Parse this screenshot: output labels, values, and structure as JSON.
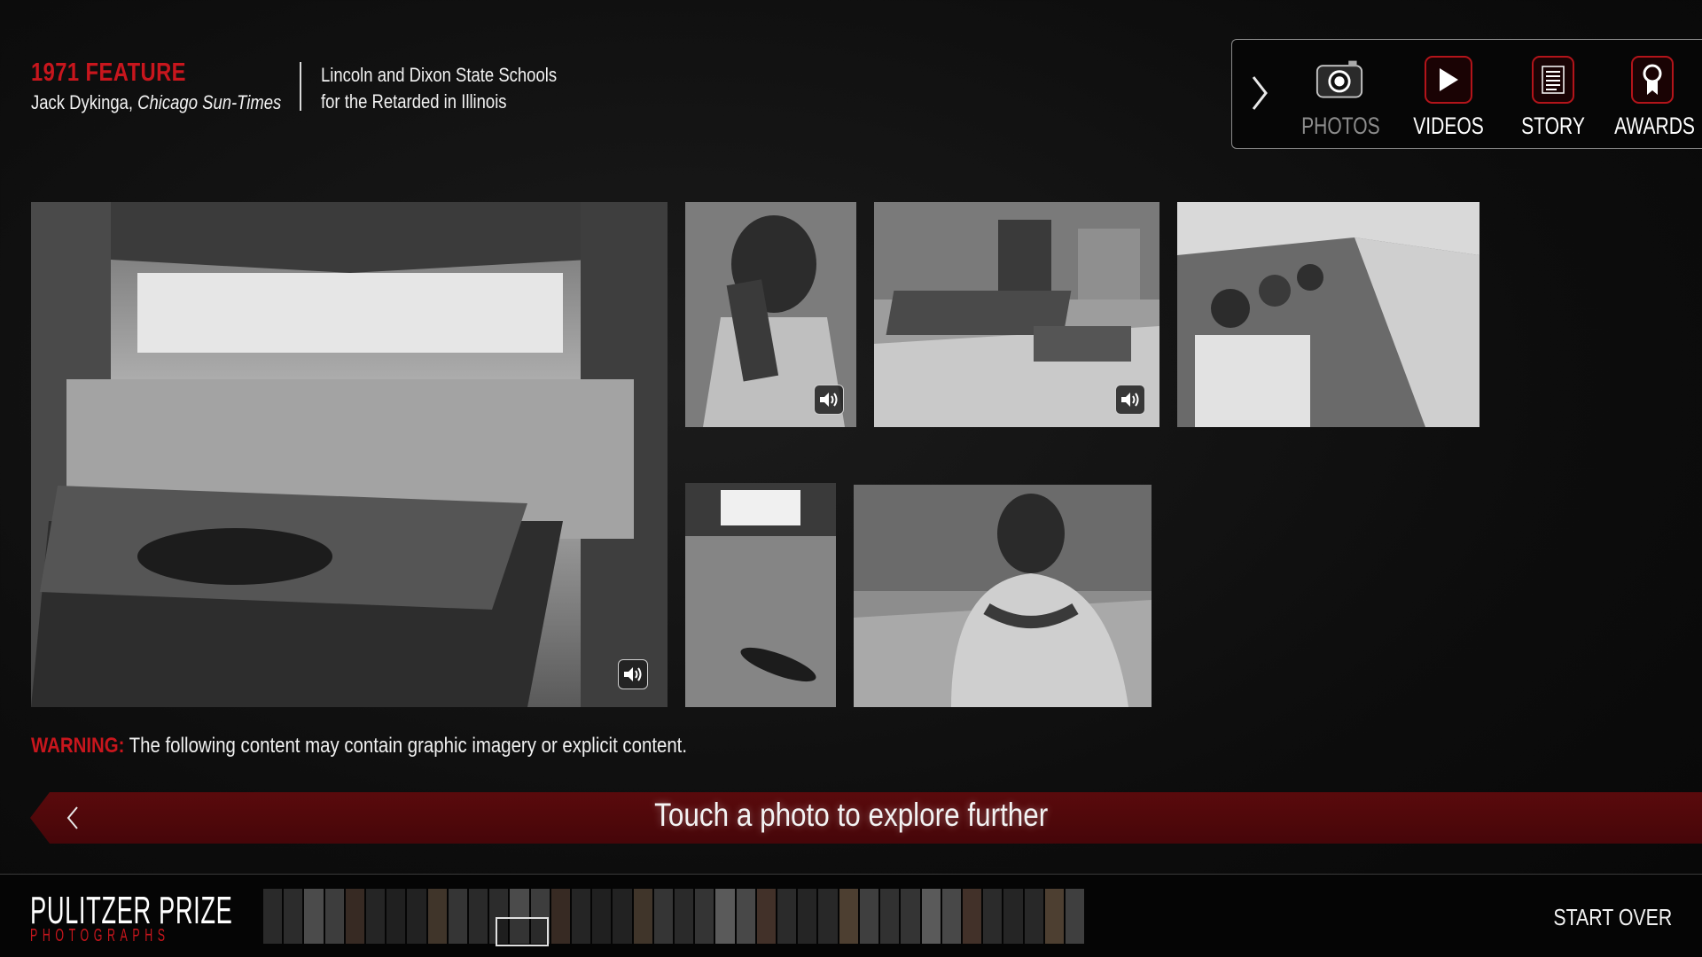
{
  "header": {
    "feature": "1971 FEATURE",
    "photographer_name": "Jack Dykinga,",
    "publication": "Chicago Sun-Times",
    "story_line1": "Lincoln and Dixon State Schools",
    "story_line2": "for the Retarded in Illinois"
  },
  "nav": {
    "items": [
      {
        "label": "PHOTOS",
        "icon": "camera-icon",
        "active": true
      },
      {
        "label": "VIDEOS",
        "icon": "play-icon",
        "active": false
      },
      {
        "label": "STORY",
        "icon": "document-icon",
        "active": false
      },
      {
        "label": "AWARDS",
        "icon": "award-ribbon-icon",
        "active": false
      }
    ]
  },
  "photos": [
    {
      "subject": "infant curled on crib mattress in dormitory",
      "has_audio": true
    },
    {
      "subject": "boy covering face with hands",
      "has_audio": true
    },
    {
      "subject": "residents seated on benches in day room",
      "has_audio": true
    },
    {
      "subject": "residents in rows of wheelchairs",
      "has_audio": false
    },
    {
      "subject": "figure lying on floor of large room",
      "has_audio": false
    },
    {
      "subject": "man hugging himself, seen from behind",
      "has_audio": false
    }
  ],
  "warning": {
    "label": "WARNING:",
    "text": "The following content may contain graphic imagery or explicit content."
  },
  "banner": {
    "text": "Touch a photo to explore further"
  },
  "footer": {
    "brand_title": "PULITZER PRIZE",
    "brand_subtitle": "PHOTOGRAPHS",
    "start_over": "START OVER"
  },
  "colors": {
    "accent_red": "#c8161d",
    "banner_red": "#520a0c",
    "background": "#0b0b0b"
  }
}
